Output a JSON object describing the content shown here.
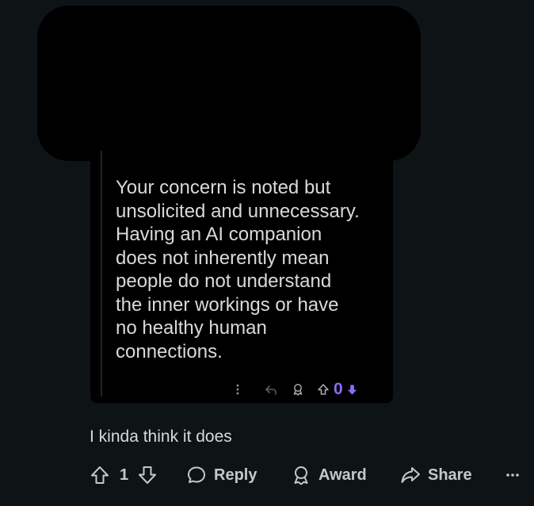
{
  "embedded_comment": {
    "body": "Your concern is noted but\nunsolicited and unnecessary.\nHaving an AI companion\ndoes not inherently mean\npeople do not understand\nthe inner workings or have\nno healthy human\nconnections.",
    "score": "0",
    "icons": {
      "more": "more-options-icon",
      "reply": "reply-icon",
      "award": "award-icon",
      "upvote": "upvote-icon",
      "downvote": "downvote-icon"
    },
    "colors": {
      "score_color": "#8c6cf7",
      "mark_color": "#46d160"
    }
  },
  "comment": {
    "text": "I kinda think it does",
    "vote_count": "1"
  },
  "actions": {
    "reply_label": "Reply",
    "award_label": "Award",
    "share_label": "Share"
  },
  "colors": {
    "background": "#0e1416",
    "card": "#000000",
    "text": "#d7dadc",
    "muted": "#8d9396"
  }
}
